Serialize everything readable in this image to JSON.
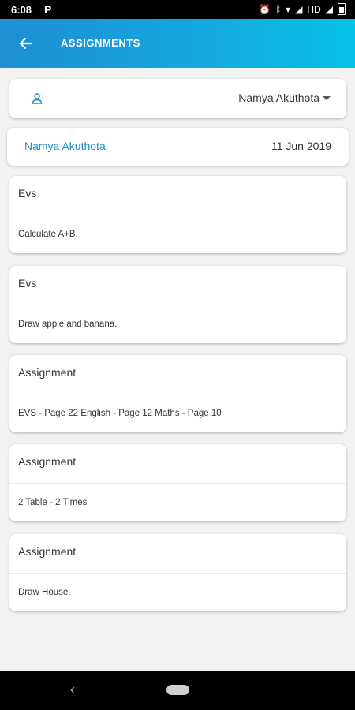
{
  "status": {
    "time": "6:08",
    "app_glyph": "P",
    "network": "HD"
  },
  "header": {
    "title": "ASSIGNMENTS"
  },
  "selector": {
    "value": "Namya Akuthota"
  },
  "student": {
    "name": "Namya Akuthota",
    "date": "11 Jun 2019"
  },
  "assignments": [
    {
      "title": "Evs",
      "description": "Calculate A+B."
    },
    {
      "title": "Evs",
      "description": "Draw apple and banana."
    },
    {
      "title": "Assignment",
      "description": "EVS - Page 22 English - Page 12 Maths - Page 10"
    },
    {
      "title": "Assignment",
      "description": "2 Table - 2 Times"
    },
    {
      "title": "Assignment",
      "description": "Draw House."
    }
  ],
  "colors": {
    "app_bar_start": "#1e8fd3",
    "app_bar_end": "#06c3e8",
    "accent": "#1a8fc8",
    "background": "#f2f2f2"
  }
}
